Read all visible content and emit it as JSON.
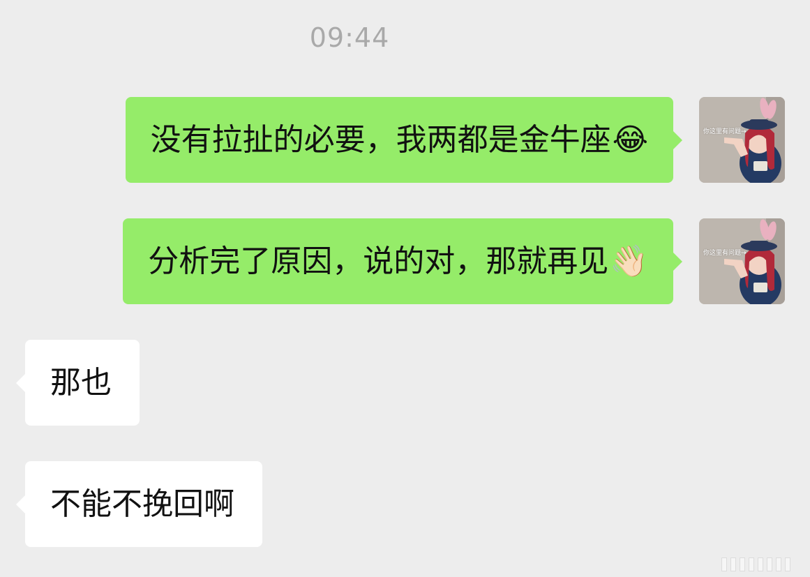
{
  "chat": {
    "timestamp": "09:44",
    "messages": [
      {
        "direction": "sent",
        "text": "没有拉扯的必要，我两都是金牛座",
        "emoji": "😂",
        "emoji_name": "laughing-tears-icon"
      },
      {
        "direction": "sent",
        "text": "分析完了原因，说的对，那就再见",
        "emoji": "👋🏻",
        "emoji_name": "waving-hand-icon"
      },
      {
        "direction": "received",
        "text": "那也"
      },
      {
        "direction": "received",
        "text": "不能不挽回啊"
      }
    ],
    "avatar_caption": "你这里有问题→"
  },
  "colors": {
    "background": "#ededed",
    "sent_bubble": "#95ec69",
    "received_bubble": "#ffffff",
    "timestamp_text": "#a9a9a9"
  }
}
